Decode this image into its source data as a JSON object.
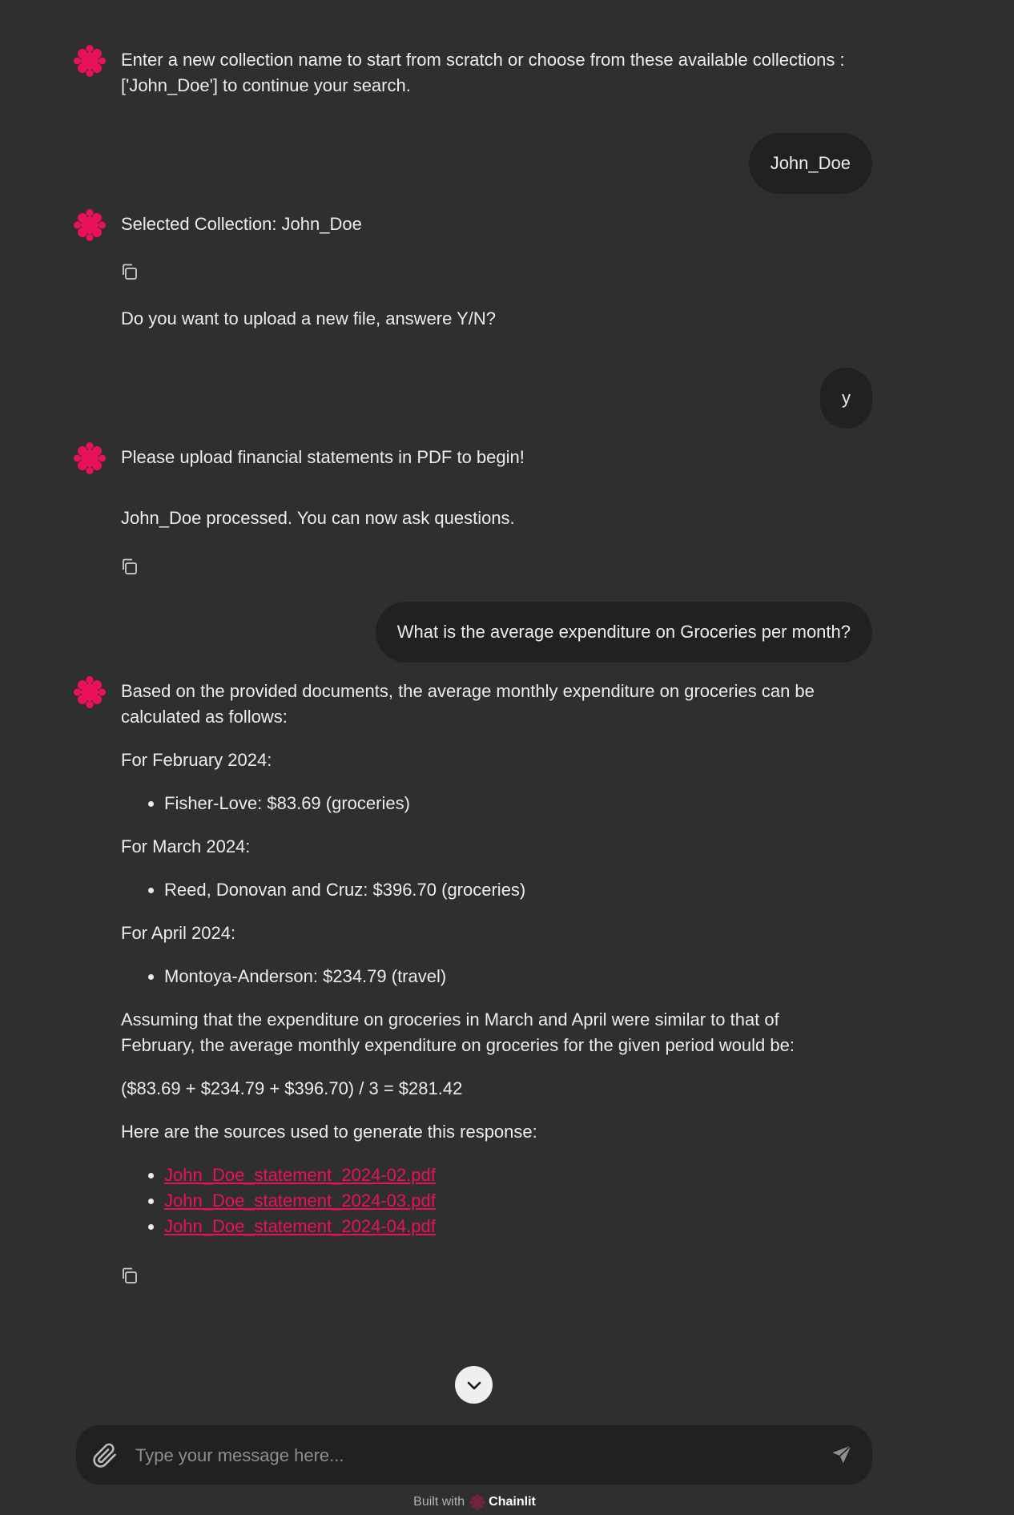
{
  "colors": {
    "background": "#2f2f2f",
    "bubble": "#212121",
    "accent": "#e8115a",
    "text": "#ececec"
  },
  "icons": {
    "assistant_avatar": "chainlit-logo-icon",
    "copy": "copy-icon",
    "scroll_down": "chevron-down-icon",
    "attach": "paperclip-icon",
    "send": "send-icon"
  },
  "conversation": {
    "m1_assistant": "Enter a new collection name to start from scratch or choose from these available collections : ['John_Doe'] to continue your search.",
    "m2_user": "John_Doe",
    "m3_assistant": "Selected Collection: John_Doe",
    "m3b_assistant": "Do you want to upload a new file, answere Y/N?",
    "m4_user": "y",
    "m5_assistant": "Please upload financial statements in PDF to begin!",
    "m5b_assistant": "John_Doe processed. You can now ask questions.",
    "m6_user": "What is the average expenditure on Groceries per month?",
    "m7": {
      "intro": "Based on the provided documents, the average monthly expenditure on groceries can be calculated as follows:",
      "feb_heading": "For February 2024:",
      "feb_item": "Fisher-Love: $83.69 (groceries)",
      "mar_heading": "For March 2024:",
      "mar_item": "Reed, Donovan and Cruz: $396.70 (groceries)",
      "apr_heading": "For April 2024:",
      "apr_item": "Montoya-Anderson: $234.79 (travel)",
      "assumption": "Assuming that the expenditure on groceries in March and April were similar to that of February, the average monthly expenditure on groceries for the given period would be:",
      "formula": "($83.69 + $234.79 + $396.70) / 3 = $281.42",
      "sources_heading": "Here are the sources used to generate this response:",
      "sources": [
        "John_Doe_statement_2024-02.pdf",
        "John_Doe_statement_2024-03.pdf",
        "John_Doe_statement_2024-04.pdf"
      ]
    }
  },
  "composer": {
    "placeholder": "Type your message here..."
  },
  "footer": {
    "built_with": "Built with",
    "brand": "Chainlit"
  }
}
